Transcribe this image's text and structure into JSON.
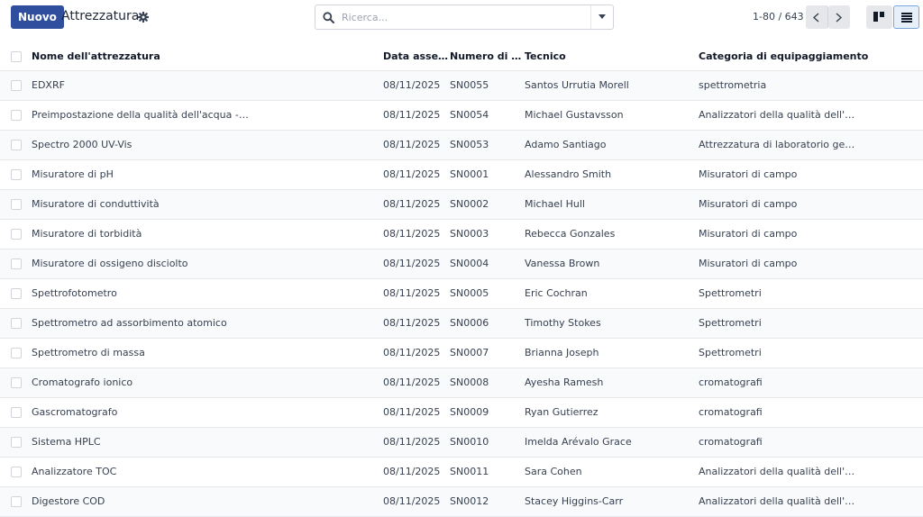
{
  "control_panel": {
    "new_button": "Nuovo",
    "title": "Attrezzatura",
    "search_placeholder": "Ricerca...",
    "pager": "1-80 / 643"
  },
  "columns": {
    "name": "Nome dell'attrezzatura",
    "date": "Data asse…",
    "serial": "Numero di …",
    "technician": "Tecnico",
    "category": "Categoria di equipaggiamento"
  },
  "rows": [
    {
      "name": "EDXRF",
      "date": "08/11/2025",
      "serial": "SN0055",
      "technician": "Santos Urrutia Morell",
      "category": "spettrometria"
    },
    {
      "name": "Preimpostazione della qualità dell'acqua -…",
      "date": "08/11/2025",
      "serial": "SN0054",
      "technician": "Michael Gustavsson",
      "category": "Analizzatori della qualità dell'…"
    },
    {
      "name": "Spectro 2000 UV-Vis",
      "date": "08/11/2025",
      "serial": "SN0053",
      "technician": "Adamo Santiago",
      "category": "Attrezzatura di laboratorio ge…"
    },
    {
      "name": "Misuratore di pH",
      "date": "08/11/2025",
      "serial": "SN0001",
      "technician": "Alessandro Smith",
      "category": "Misuratori di campo"
    },
    {
      "name": "Misuratore di conduttività",
      "date": "08/11/2025",
      "serial": "SN0002",
      "technician": "Michael Hull",
      "category": "Misuratori di campo"
    },
    {
      "name": "Misuratore di torbidità",
      "date": "08/11/2025",
      "serial": "SN0003",
      "technician": "Rebecca Gonzales",
      "category": "Misuratori di campo"
    },
    {
      "name": "Misuratore di ossigeno disciolto",
      "date": "08/11/2025",
      "serial": "SN0004",
      "technician": "Vanessa Brown",
      "category": "Misuratori di campo"
    },
    {
      "name": "Spettrofotometro",
      "date": "08/11/2025",
      "serial": "SN0005",
      "technician": "Eric Cochran",
      "category": "Spettrometri"
    },
    {
      "name": "Spettrometro ad assorbimento atomico",
      "date": "08/11/2025",
      "serial": "SN0006",
      "technician": "Timothy Stokes",
      "category": "Spettrometri"
    },
    {
      "name": "Spettrometro di massa",
      "date": "08/11/2025",
      "serial": "SN0007",
      "technician": "Brianna Joseph",
      "category": "Spettrometri"
    },
    {
      "name": "Cromatografo ionico",
      "date": "08/11/2025",
      "serial": "SN0008",
      "technician": "Ayesha Ramesh",
      "category": "cromatografi"
    },
    {
      "name": "Gascromatografo",
      "date": "08/11/2025",
      "serial": "SN0009",
      "technician": "Ryan Gutierrez",
      "category": "cromatografi"
    },
    {
      "name": "Sistema HPLC",
      "date": "08/11/2025",
      "serial": "SN0010",
      "technician": "Imelda Arévalo Grace",
      "category": "cromatografi"
    },
    {
      "name": "Analizzatore TOC",
      "date": "08/11/2025",
      "serial": "SN0011",
      "technician": "Sara Cohen",
      "category": "Analizzatori della qualità dell'…"
    },
    {
      "name": "Digestore COD",
      "date": "08/11/2025",
      "serial": "SN0012",
      "technician": "Stacey Higgins-Carr",
      "category": "Analizzatori della qualità dell'…"
    }
  ],
  "icons": {
    "gear": "gear-icon",
    "search": "search-icon",
    "dropdown": "caret-down-icon",
    "prev": "chevron-left-icon",
    "next": "chevron-right-icon",
    "kanban": "kanban-view-icon",
    "list": "list-view-icon"
  },
  "colors": {
    "primary": "#2f4f9e",
    "active_view_border": "#7aa6de"
  }
}
